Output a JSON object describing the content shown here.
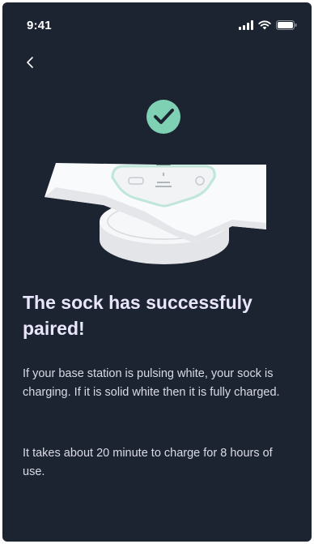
{
  "status_bar": {
    "time": "9:41",
    "icons": [
      "signal-icon",
      "wifi-icon",
      "battery-icon"
    ]
  },
  "nav": {
    "back_icon": "chevron-left-icon"
  },
  "illustration": {
    "badge_icon": "check-circle-icon",
    "badge_color": "#7fd1b3",
    "device": "sock-on-base-station"
  },
  "content": {
    "title": "The sock has successfuly paired!",
    "paragraph_1": "If your base station is pulsing white,  your sock is charging. If it is solid white then it is fully charged.",
    "paragraph_2": "It takes about 20 minute to charge for 8 hours of use."
  },
  "colors": {
    "background": "#1d2431",
    "title": "#e9e6fb",
    "body": "#d9dbe6",
    "accent": "#7fd1b3"
  }
}
